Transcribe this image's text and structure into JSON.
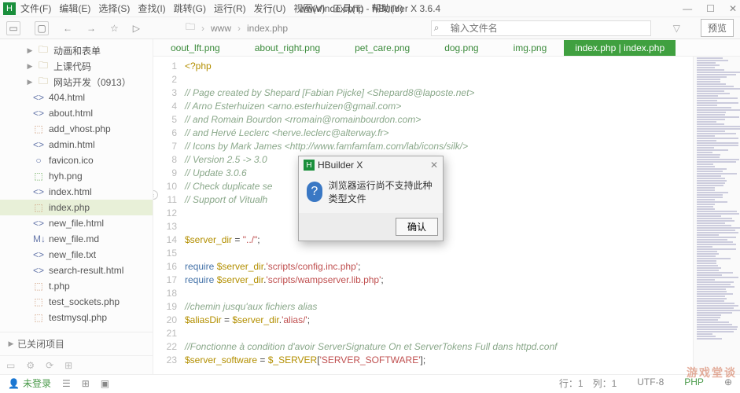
{
  "title": "www/index.php - HBuilder X 3.6.4",
  "menu": [
    "文件(F)",
    "编辑(E)",
    "选择(S)",
    "查找(I)",
    "跳转(G)",
    "运行(R)",
    "发行(U)",
    "视图(V)",
    "工具(T)",
    "帮助(Y)"
  ],
  "breadcrumb": [
    "www",
    "index.php"
  ],
  "search_placeholder": "输入文件名",
  "preview_btn": "预览",
  "tree_folders": [
    {
      "label": "动画和表单"
    },
    {
      "label": "上课代码"
    },
    {
      "label": "网站开发（0913）"
    }
  ],
  "tree_files": [
    {
      "ico": "<>",
      "label": "404.html",
      "cls": "blue"
    },
    {
      "ico": "<>",
      "label": "about.html",
      "cls": "blue"
    },
    {
      "ico": "⬚",
      "label": "add_vhost.php",
      "cls": "orange"
    },
    {
      "ico": "<>",
      "label": "admin.html",
      "cls": "blue"
    },
    {
      "ico": "○",
      "label": "favicon.ico",
      "cls": "blue"
    },
    {
      "ico": "⬚",
      "label": "hyh.png",
      "cls": "green"
    },
    {
      "ico": "<>",
      "label": "index.html",
      "cls": "blue"
    },
    {
      "ico": "⬚",
      "label": "index.php",
      "cls": "orange",
      "sel": true
    },
    {
      "ico": "<>",
      "label": "new_file.html",
      "cls": "blue"
    },
    {
      "ico": "M↓",
      "label": "new_file.md",
      "cls": "blue"
    },
    {
      "ico": "<>",
      "label": "new_file.txt",
      "cls": "blue"
    },
    {
      "ico": "<>",
      "label": "search-result.html",
      "cls": "blue"
    },
    {
      "ico": "⬚",
      "label": "t.php",
      "cls": "orange"
    },
    {
      "ico": "⬚",
      "label": "test_sockets.php",
      "cls": "orange"
    },
    {
      "ico": "⬚",
      "label": "testmysql.php",
      "cls": "orange"
    }
  ],
  "closed_projects": "已关闭项目",
  "tabs": [
    "oout_lft.png",
    "about_right.png",
    "pet_care.png",
    "dog.png",
    "img.png"
  ],
  "active_tab": "index.php | index.php",
  "code_lines": [
    {
      "n": 1,
      "html": "<span class='kw'>&lt;?php</span>"
    },
    {
      "n": 2,
      "html": ""
    },
    {
      "n": 3,
      "html": "<span class='cm'>// Page created by Shepard [Fabian Pijcke] &lt;Shepard8@laposte.net&gt;</span>"
    },
    {
      "n": 4,
      "html": "<span class='cm'>// Arno Esterhuizen &lt;arno.esterhuizen@gmail.com&gt;</span>"
    },
    {
      "n": 5,
      "html": "<span class='cm'>// and Romain Bourdon &lt;rromain@romainbourdon.com&gt;</span>"
    },
    {
      "n": 6,
      "html": "<span class='cm'>// and Hervé Leclerc &lt;herve.leclerc@alterway.fr&gt;</span>"
    },
    {
      "n": 7,
      "html": "<span class='cm'>// Icons by Mark James &lt;http://www.famfamfam.com/lab/icons/silk/&gt;</span>"
    },
    {
      "n": 8,
      "html": "<span class='cm'>// Version 2.5 -&gt; 3.0                          Otomatic</span>"
    },
    {
      "n": 9,
      "html": "<span class='cm'>// Update 3.0.6</span>"
    },
    {
      "n": 10,
      "html": "<span class='cm'>// Check duplicate se</span>"
    },
    {
      "n": 11,
      "html": "<span class='cm'>// Support of Vitualh</span>"
    },
    {
      "n": 12,
      "html": ""
    },
    {
      "n": 13,
      "html": ""
    },
    {
      "n": 14,
      "html": "<span class='var'>$server_dir</span> = <span class='str'>\"../\"</span>;"
    },
    {
      "n": 15,
      "html": ""
    },
    {
      "n": 16,
      "html": "<span class='fn'>require</span> <span class='var'>$server_dir</span>.<span class='str'>'scripts/config.inc.php'</span>;"
    },
    {
      "n": 17,
      "html": "<span class='fn'>require</span> <span class='var'>$server_dir</span>.<span class='str'>'scripts/wampserver.lib.php'</span>;"
    },
    {
      "n": 18,
      "html": ""
    },
    {
      "n": 19,
      "html": "<span class='cm'>//chemin jusqu'aux fichiers alias</span>"
    },
    {
      "n": 20,
      "html": "<span class='var'>$aliasDir</span> = <span class='var'>$server_dir</span>.<span class='str'>'alias/'</span>;"
    },
    {
      "n": 21,
      "html": ""
    },
    {
      "n": 22,
      "html": "<span class='cm'>//Fonctionne à condition d'avoir ServerSignature On et ServerTokens Full dans httpd.conf</span>"
    },
    {
      "n": 23,
      "html": "<span class='var'>$server_software</span> = <span class='var'>$_SERVER</span>[<span class='str'>'SERVER_SOFTWARE'</span>];"
    }
  ],
  "dialog": {
    "title": "HBuilder X",
    "message": "浏览器运行尚不支持此种类型文件",
    "ok": "确认"
  },
  "status": {
    "login": "未登录",
    "pos": "行：1　列：1",
    "enc": "UTF-8",
    "lang": "PHP"
  },
  "watermark": "游戏堂谈"
}
